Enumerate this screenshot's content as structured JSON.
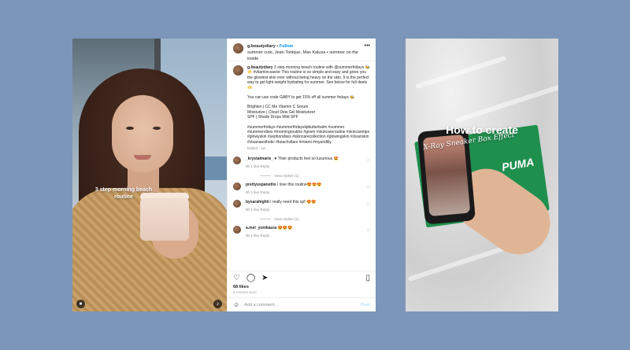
{
  "post": {
    "username": "g.beautydiary",
    "follow_label": "Follow",
    "dot": "•",
    "audio": "summer cute, Jean Tonique, Max Kaluza • summer on the inside",
    "more": "•••",
    "caption": {
      "username": "g.beautydiary",
      "line1": "3 step morning beach routine with @summerfridays 🐝☀️ #vitamincsavior This routine is so simple and easy and gives you the glowiest skin ever without being heavy on the skin. It is the perfect way to get light weight hydrating for summer. See below for full deets 🫶",
      "line2": "You can use code GABY to get 15% off all summer fridays 🐝",
      "products": [
        "Brighten | CC Me Vitamin C Serum",
        "Moisturize | Cloud Dew Gel Moisturizer",
        "SPF | Shade Drops Mild SPF"
      ],
      "hashtags": "#summerfridays #summerfridayslipbutterbalm #summer #summervibes #morningroutine #grwm #skincareroutine #skincaretips #glowyskin #sephorafavs #skincarecollection #glowingskin #cleanskin #cleanaesthetic #beachvibes #miami #myandlily",
      "meta": "Edited · 1w"
    },
    "comments": [
      {
        "user": "_krystalmarie_",
        "text": "♥ Their products feel so luxurious 🤩",
        "meta": "8h  1 like  Reply",
        "replies": "View replies (1)"
      },
      {
        "user": "prettyuspanetlis",
        "text": "I love this routine😍😍😍",
        "meta": "8h  1 like  Reply"
      },
      {
        "user": "bysarahighti",
        "text": "I really need this spf 😍😍",
        "meta": "8h  1 like  Reply",
        "replies": "View replies (1)"
      },
      {
        "user": "a.mel_yonikaura",
        "text": "😍😍😍",
        "meta": "8h  1 like  Reply"
      }
    ],
    "likes": "68 likes",
    "when": "8 HOURS AGO",
    "add_comment_placeholder": "Add a comment...",
    "post_label": "Post"
  },
  "media": {
    "overlay_text": "3 step morning beach routine"
  },
  "reel": {
    "title": "How to create",
    "subtitle": "X-Ray Sneaker Box Effect",
    "brand": "PUMA"
  }
}
